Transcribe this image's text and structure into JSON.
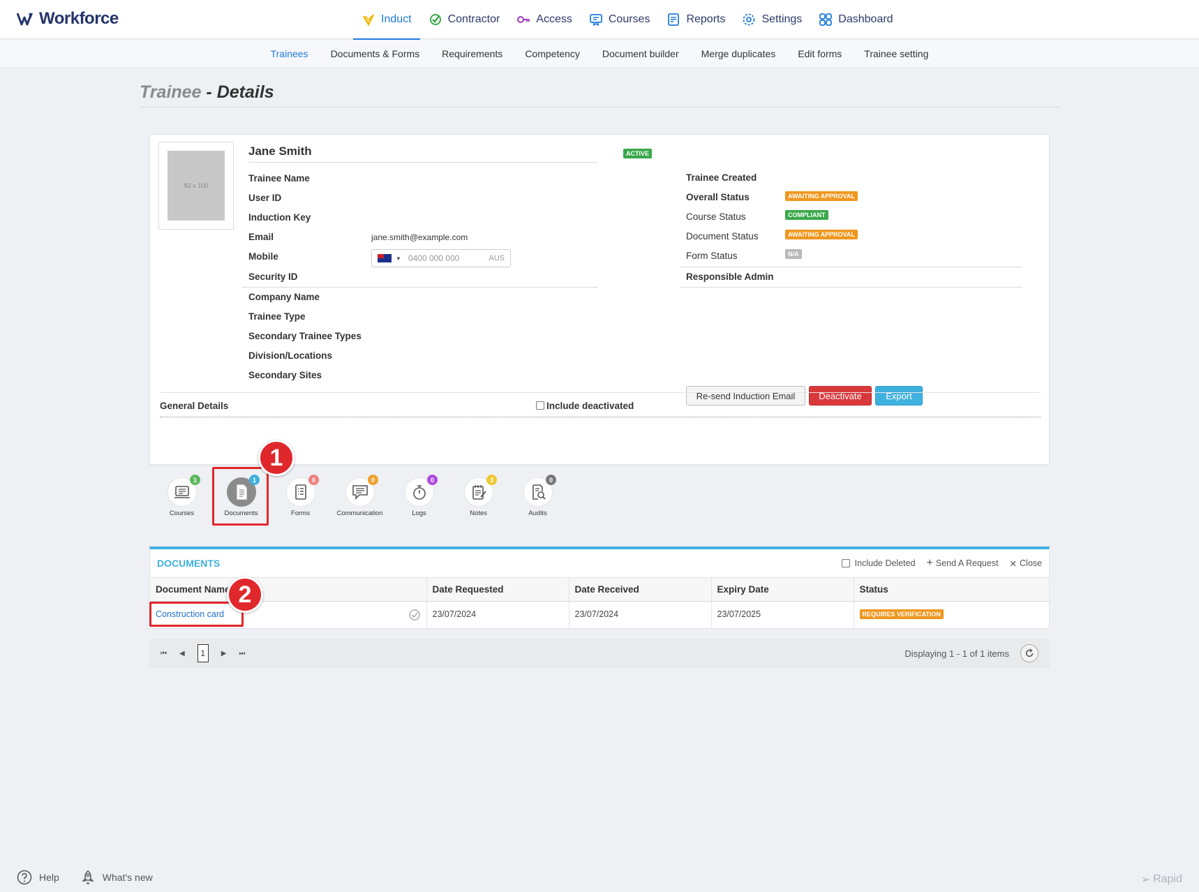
{
  "app": {
    "brand": "Workforce"
  },
  "topnav": [
    {
      "label": "Induct",
      "icon": "induct-icon",
      "active": true
    },
    {
      "label": "Contractor",
      "icon": "contractor-icon",
      "active": false
    },
    {
      "label": "Access",
      "icon": "access-key-icon",
      "active": false
    },
    {
      "label": "Courses",
      "icon": "courses-icon",
      "active": false
    },
    {
      "label": "Reports",
      "icon": "reports-icon",
      "active": false
    },
    {
      "label": "Settings",
      "icon": "gear-icon",
      "active": false
    },
    {
      "label": "Dashboard",
      "icon": "dashboard-icon",
      "active": false
    }
  ],
  "subnav": [
    {
      "label": "Trainees",
      "active": true
    },
    {
      "label": "Documents & Forms"
    },
    {
      "label": "Requirements"
    },
    {
      "label": "Competency"
    },
    {
      "label": "Document builder"
    },
    {
      "label": "Merge duplicates"
    },
    {
      "label": "Edit forms"
    },
    {
      "label": "Trainee setting"
    }
  ],
  "page": {
    "title_light": "Trainee",
    "title_bold": " - Details"
  },
  "trainee": {
    "photo_placeholder": "82 x 100",
    "name": "Jane Smith",
    "status_badge": "ACTIVE",
    "labels": {
      "trainee_name": "Trainee Name",
      "user_id": "User ID",
      "induction_key": "Induction Key",
      "email": "Email",
      "mobile": "Mobile",
      "security_id": "Security ID",
      "company_name": "Company Name",
      "trainee_type": "Trainee Type",
      "secondary_trainee_types": "Secondary Trainee Types",
      "division_locations": "Division/Locations",
      "secondary_sites": "Secondary Sites"
    },
    "email": "jane.smith@example.com",
    "mobile_placeholder": "0400 000 000",
    "mobile_country": "AUS",
    "right": {
      "trainee_created": "Trainee Created",
      "overall_status": "Overall Status",
      "overall_status_badge": "AWAITING APPROVAL",
      "course_status": "Course Status",
      "course_status_badge": "COMPLIANT",
      "document_status": "Document Status",
      "document_status_badge": "AWAITING APPROVAL",
      "form_status": "Form Status",
      "form_status_badge": "N/A",
      "responsible_admin": "Responsible Admin"
    },
    "buttons": {
      "resend": "Re-send Induction Email",
      "deactivate": "Deactivate",
      "export": "Export"
    },
    "general_details": "General Details",
    "include_deactivated": "Include deactivated"
  },
  "tabs": [
    {
      "label": "Courses",
      "count": "1",
      "count_color": "#5cb85c",
      "icon": "courses-tab-icon"
    },
    {
      "label": "Documents",
      "count": "1",
      "count_color": "#3fb1de",
      "icon": "documents-tab-icon",
      "active": true
    },
    {
      "label": "Forms",
      "count": "0",
      "count_color": "#f08080",
      "icon": "forms-tab-icon"
    },
    {
      "label": "Communication",
      "count": "0",
      "count_color": "#f0a030",
      "icon": "communication-tab-icon"
    },
    {
      "label": "Logs",
      "count": "0",
      "count_color": "#b04ae0",
      "icon": "logs-tab-icon"
    },
    {
      "label": "Notes",
      "count": "3",
      "count_color": "#f0c830",
      "icon": "notes-tab-icon"
    },
    {
      "label": "Audits",
      "count": "0",
      "count_color": "#777777",
      "icon": "audits-tab-icon"
    }
  ],
  "callouts": {
    "first": "1",
    "second": "2"
  },
  "documents": {
    "title": "DOCUMENTS",
    "include_deleted": "Include Deleted",
    "send_request": "Send A Request",
    "close": "Close",
    "columns": [
      "Document Name",
      "Date Requested",
      "Date Received",
      "Expiry Date",
      "Status"
    ],
    "rows": [
      {
        "name": "Construction card",
        "requested": "23/07/2024",
        "received": "23/07/2024",
        "expiry": "23/07/2025",
        "status": "REQUIRES VERIFICATION"
      }
    ]
  },
  "pager": {
    "page": "1",
    "display": "Displaying 1 - 1 of 1 items"
  },
  "footer": {
    "help": "Help",
    "whats_new": "What's new",
    "rapid": "Rapid"
  },
  "colors": {
    "accent": "#1f7ae0",
    "docs_accent": "#3fb1de",
    "danger": "#d9383a",
    "callout": "#e0282c"
  }
}
